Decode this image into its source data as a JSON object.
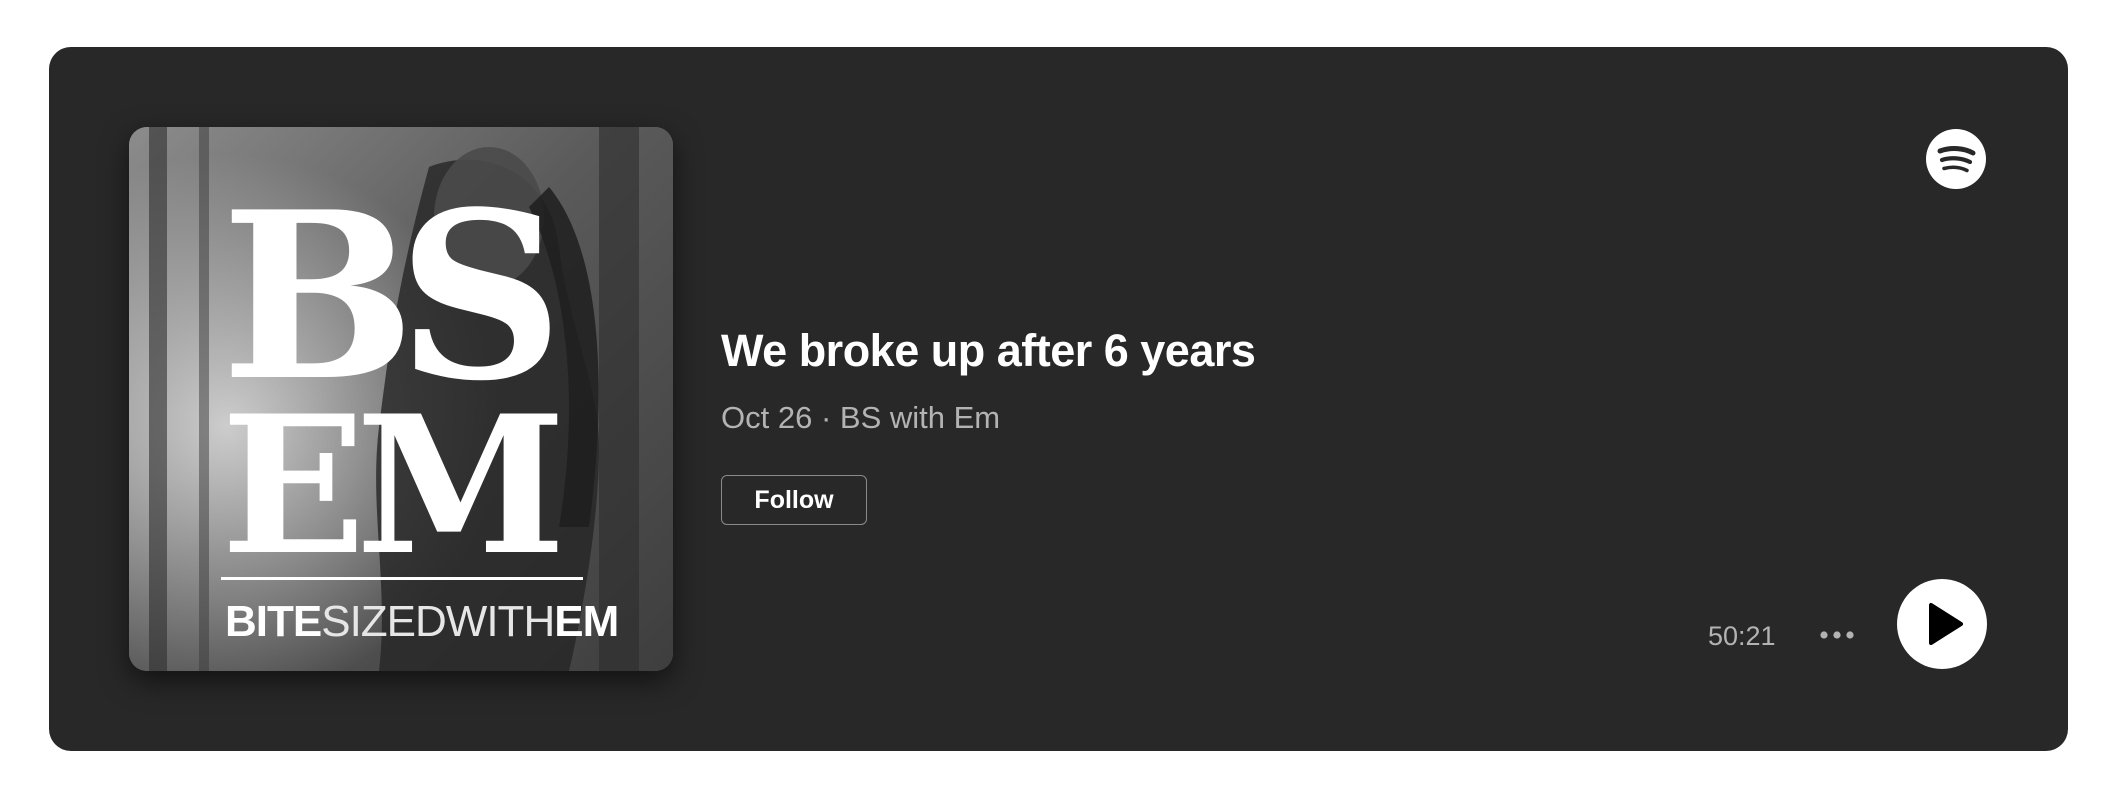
{
  "episode": {
    "title": "We broke up after 6 years",
    "date": "Oct 26",
    "separator": "·",
    "show": "BS with Em",
    "meta_line": "Oct 26 · BS with Em",
    "duration": "50:21"
  },
  "actions": {
    "follow_label": "Follow",
    "more_icon": "more-horizontal-icon",
    "play_icon": "play-icon"
  },
  "cover_art": {
    "monogram_top": "BS",
    "monogram_bottom": "EM",
    "tagline_part1": "BITE",
    "tagline_part2": "SIZEDWITH",
    "tagline_part3": "EM"
  },
  "branding": {
    "logo": "spotify-logo-icon"
  },
  "colors": {
    "card_background": "#282828",
    "page_background": "#ffffff",
    "title_text": "#ffffff",
    "secondary_text": "#b3b3b3",
    "play_button": "#ffffff"
  }
}
